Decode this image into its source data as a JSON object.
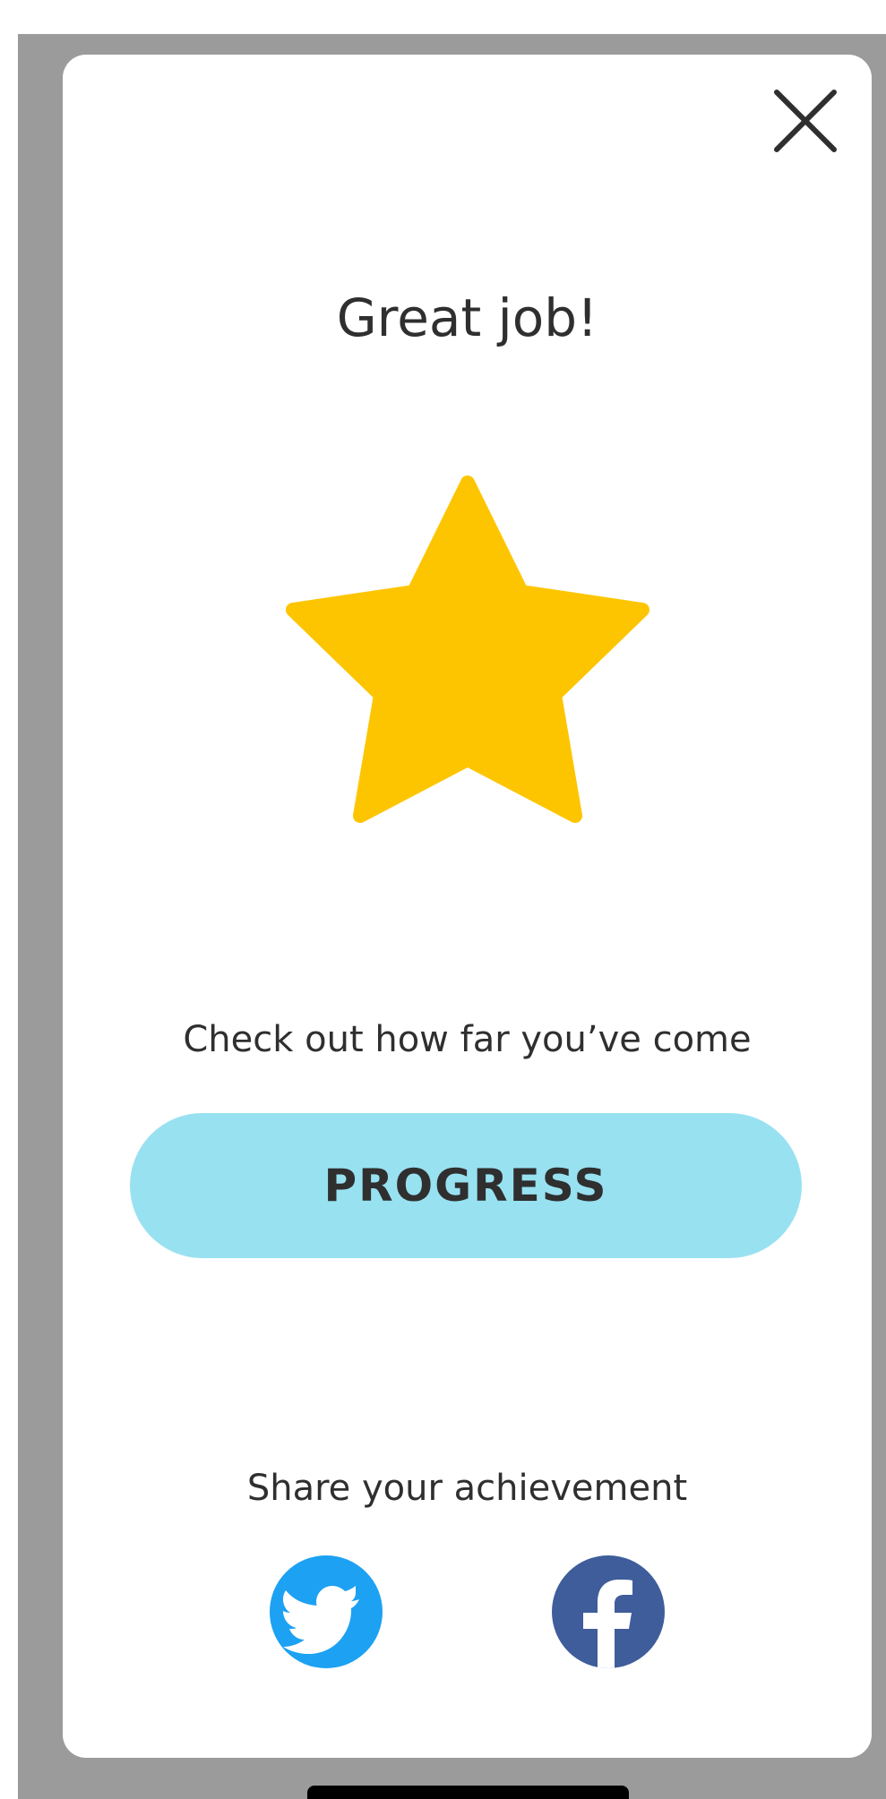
{
  "dialog": {
    "title": "Great job!",
    "subtitle": "Check out how far you’ve come",
    "primary_button": "PROGRESS",
    "share_label": "Share your achievement"
  },
  "icons": {
    "close": "close-icon",
    "star": "star-icon",
    "twitter": "twitter-icon",
    "facebook": "facebook-icon"
  },
  "colors": {
    "overlay": "#9b9b9b",
    "card": "#ffffff",
    "star": "#fdc500",
    "button": "#98e1f1",
    "text": "#2f2f2f",
    "twitter": "#1da1f2",
    "facebook": "#3f5d9b"
  }
}
